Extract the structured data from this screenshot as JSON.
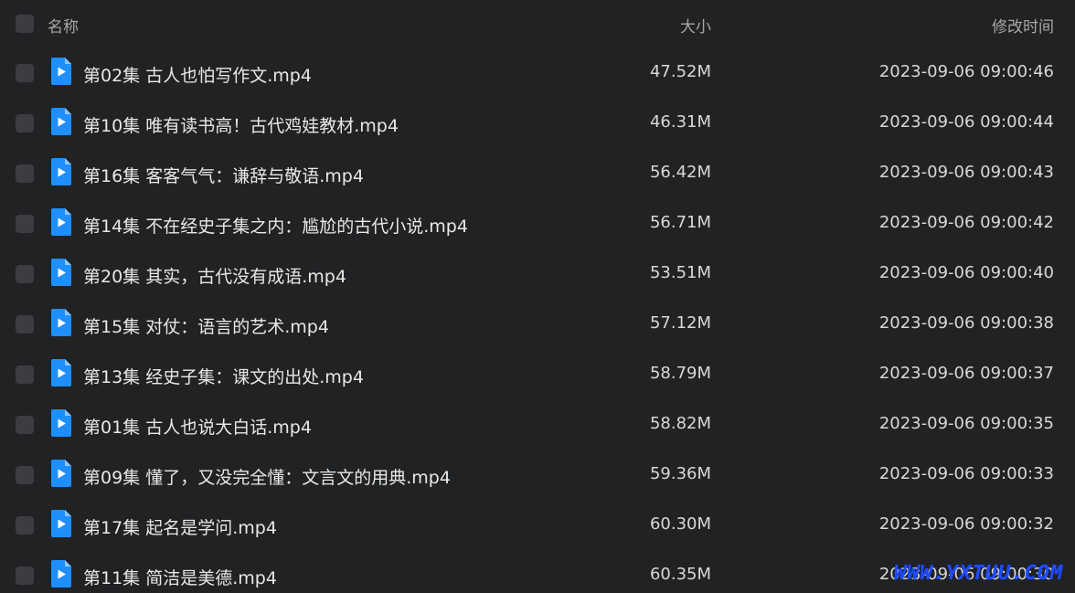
{
  "header": {
    "name_label": "名称",
    "size_label": "大小",
    "time_label": "修改时间"
  },
  "files": [
    {
      "name": "第02集 古人也怕写作文.mp4",
      "size": "47.52M",
      "modified": "2023-09-06 09:00:46"
    },
    {
      "name": "第10集 唯有读书高！古代鸡娃教材.mp4",
      "size": "46.31M",
      "modified": "2023-09-06 09:00:44"
    },
    {
      "name": "第16集 客客气气：谦辞与敬语.mp4",
      "size": "56.42M",
      "modified": "2023-09-06 09:00:43"
    },
    {
      "name": "第14集 不在经史子集之内：尴尬的古代小说.mp4",
      "size": "56.71M",
      "modified": "2023-09-06 09:00:42"
    },
    {
      "name": "第20集 其实，古代没有成语.mp4",
      "size": "53.51M",
      "modified": "2023-09-06 09:00:40"
    },
    {
      "name": "第15集 对仗：语言的艺术.mp4",
      "size": "57.12M",
      "modified": "2023-09-06 09:00:38"
    },
    {
      "name": "第13集 经史子集：课文的出处.mp4",
      "size": "58.79M",
      "modified": "2023-09-06 09:00:37"
    },
    {
      "name": "第01集 古人也说大白话.mp4",
      "size": "58.82M",
      "modified": "2023-09-06 09:00:35"
    },
    {
      "name": "第09集 懂了，又没完全懂：文言文的用典.mp4",
      "size": "59.36M",
      "modified": "2023-09-06 09:00:33"
    },
    {
      "name": "第17集 起名是学问.mp4",
      "size": "60.30M",
      "modified": "2023-09-06 09:00:32"
    },
    {
      "name": "第11集 简洁是美德.mp4",
      "size": "60.35M",
      "modified": "2023-09-06 09:00:30"
    }
  ],
  "watermark": "WWW.YXTUU.COM",
  "icons": {
    "file_icon": "video-file-icon",
    "file_icon_color": "#1e8fff"
  },
  "colors": {
    "background": "#202224",
    "checkbox": "#3b3d40",
    "watermark": "#1f4cff"
  }
}
